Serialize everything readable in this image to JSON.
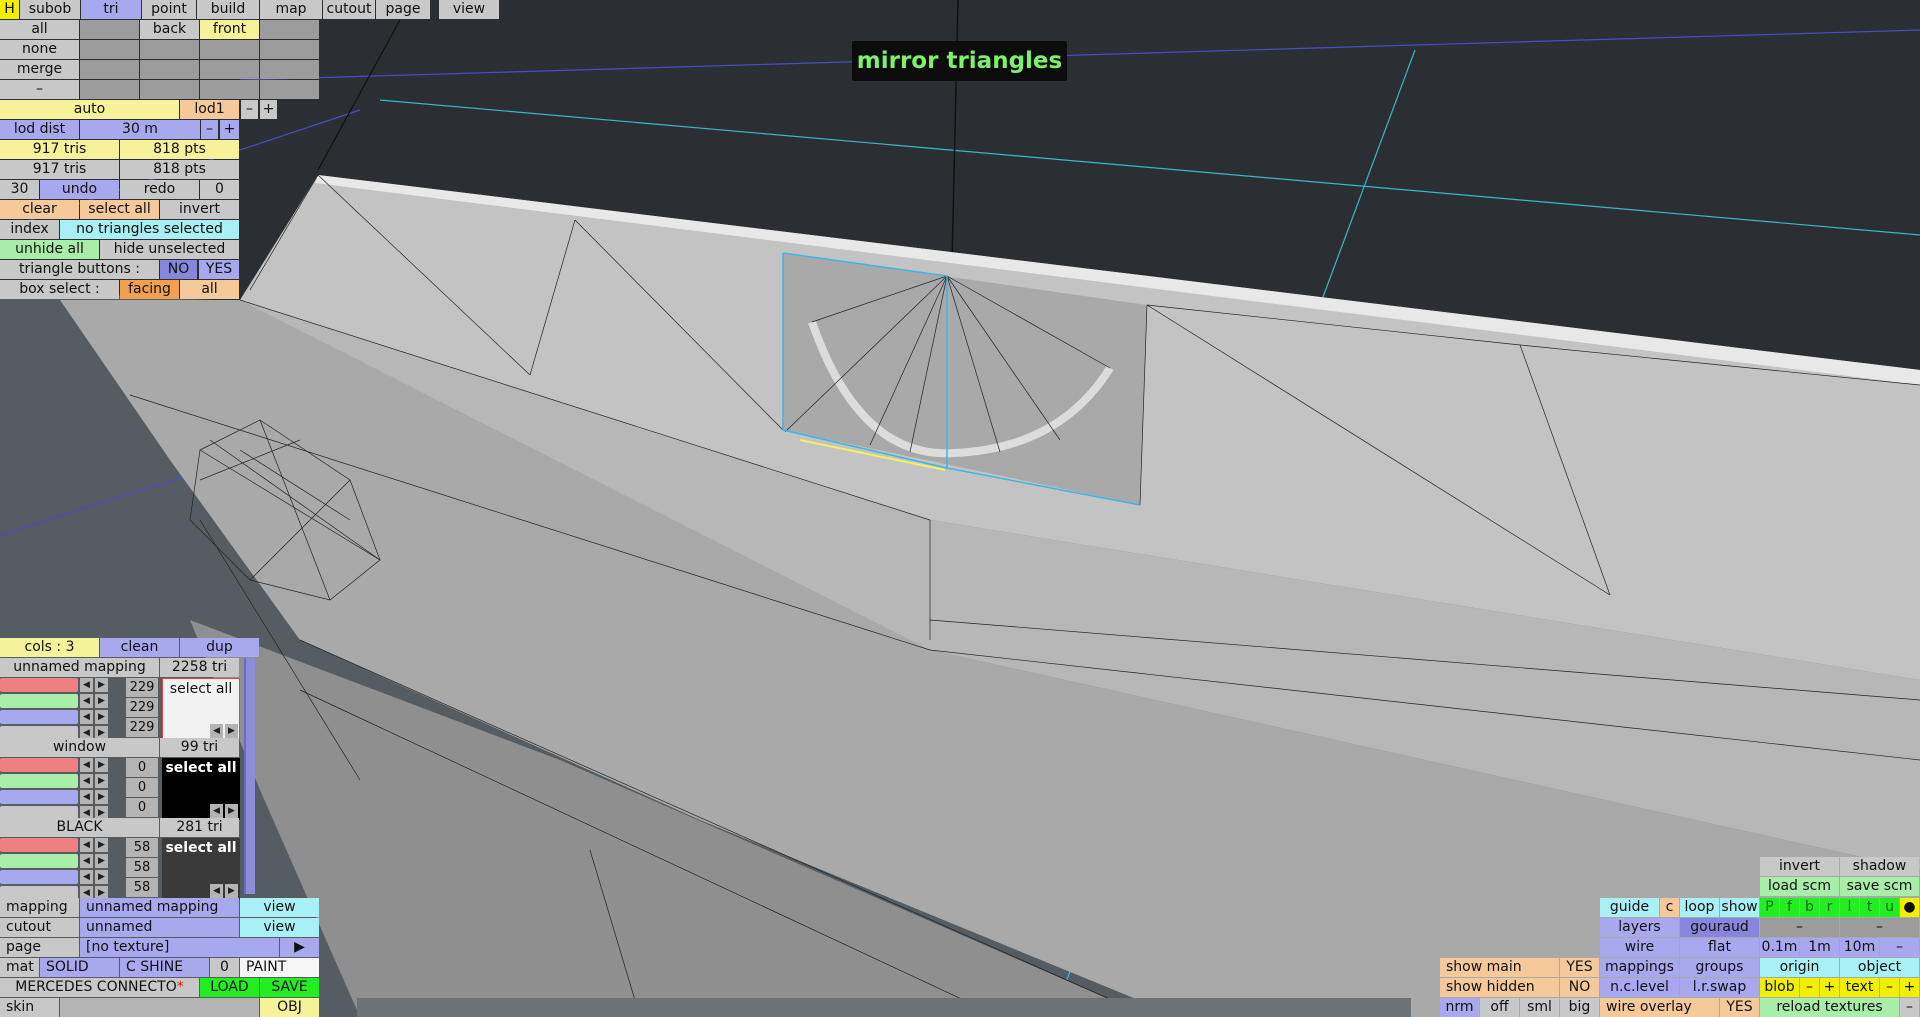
{
  "viewport_label": "mirror triangles",
  "top_menu": {
    "h": "H",
    "subob": "subob",
    "tri": "tri",
    "point": "point",
    "build": "build",
    "map": "map",
    "cutout": "cutout",
    "page": "page",
    "view": "view"
  },
  "select_grid": {
    "all": "all",
    "none": "none",
    "merge": "merge",
    "dash": "–",
    "back": "back",
    "front": "front"
  },
  "lod": {
    "auto": "auto",
    "lod1": "lod1",
    "minus": "–",
    "plus": "+",
    "dist_label": "lod dist",
    "dist_value": "30 m"
  },
  "stats": {
    "tris1": "917 tris",
    "pts1": "818 pts",
    "tris2": "917 tris",
    "pts2": "818 pts"
  },
  "undo_row": {
    "count": "30",
    "undo": "undo",
    "redo": "redo",
    "redo_count": "0"
  },
  "selection": {
    "clear": "clear",
    "select_all": "select all",
    "invert": "invert",
    "index": "index",
    "status": "no triangles selected",
    "unhide_all": "unhide all",
    "hide_unselected": "hide unselected",
    "triangle_buttons": "triangle buttons :",
    "no": "NO",
    "yes": "YES",
    "box_select": "box select :",
    "facing": "facing",
    "all": "all"
  },
  "colors_panel": {
    "cols": "cols : 3",
    "clean": "clean",
    "dup": "dup",
    "groups": [
      {
        "name": "unnamed mapping",
        "tris": "2258 tri",
        "r": "229",
        "g": "229",
        "b": "229",
        "select": "select all",
        "preview": "#f2f2f2",
        "swatches": [
          "#f08080",
          "#a8eea8",
          "#a8a8ee",
          "#c8c8c8"
        ]
      },
      {
        "name": "window",
        "tris": "99 tri",
        "r": "0",
        "g": "0",
        "b": "0",
        "select": "select all",
        "preview": "#000000",
        "swatches": [
          "#f08080",
          "#a8eea8",
          "#a8a8ee",
          "#c8c8c8"
        ]
      },
      {
        "name": "BLACK",
        "tris": "281 tri",
        "r": "58",
        "g": "58",
        "b": "58",
        "select": "select all",
        "preview": "#3a3a3a",
        "swatches": [
          "#f08080",
          "#a8eea8",
          "#a8a8ee",
          "#c8c8c8"
        ]
      }
    ]
  },
  "bottom_left": {
    "mapping_label": "mapping",
    "mapping_value": "unnamed mapping",
    "view1": "view",
    "cutout_label": "cutout",
    "cutout_value": "unnamed",
    "view2": "view",
    "page_label": "page",
    "page_value": "[no texture]",
    "page_arrow": "▶",
    "mat": "mat",
    "solid": "SOLID",
    "cshine": "C SHINE",
    "zero": "0",
    "paint": "PAINT",
    "model_name": "MERCEDES CONNECTO",
    "asterisk": "*",
    "load": "LOAD",
    "save": "SAVE",
    "skin": "skin",
    "obj": "OBJ"
  },
  "bottom_right": {
    "invert": "invert",
    "shadow": "shadow",
    "load_scm": "load scm",
    "save_scm": "save scm",
    "guide": "guide",
    "c": "c",
    "loop": "loop",
    "show": "show",
    "view_letters": [
      "P",
      "f",
      "b",
      "r",
      "l",
      "t",
      "u",
      "●"
    ],
    "layers": "layers",
    "gouraud": "gouraud",
    "dash1": "–",
    "dash2": "–",
    "wire": "wire",
    "flat": "flat",
    "d01": "0.1m",
    "d1": "1m",
    "d10": "10m",
    "dminus": "–",
    "show_main": "show main",
    "show_main_val": "YES",
    "mappings": "mappings",
    "groups": "groups",
    "origin": "origin",
    "object": "object",
    "show_hidden": "show hidden",
    "show_hidden_val": "NO",
    "nclevel": "n.c.level",
    "lrswap": "l.r.swap",
    "blob": "blob",
    "bminus": "–",
    "bplus": "+",
    "text": "text",
    "tminus": "–",
    "tplus": "+",
    "nrm": "nrm",
    "off": "off",
    "sml": "sml",
    "big": "big",
    "wire_overlay": "wire overlay",
    "wire_overlay_val": "YES",
    "reload_textures": "reload textures",
    "rminus": "–"
  }
}
